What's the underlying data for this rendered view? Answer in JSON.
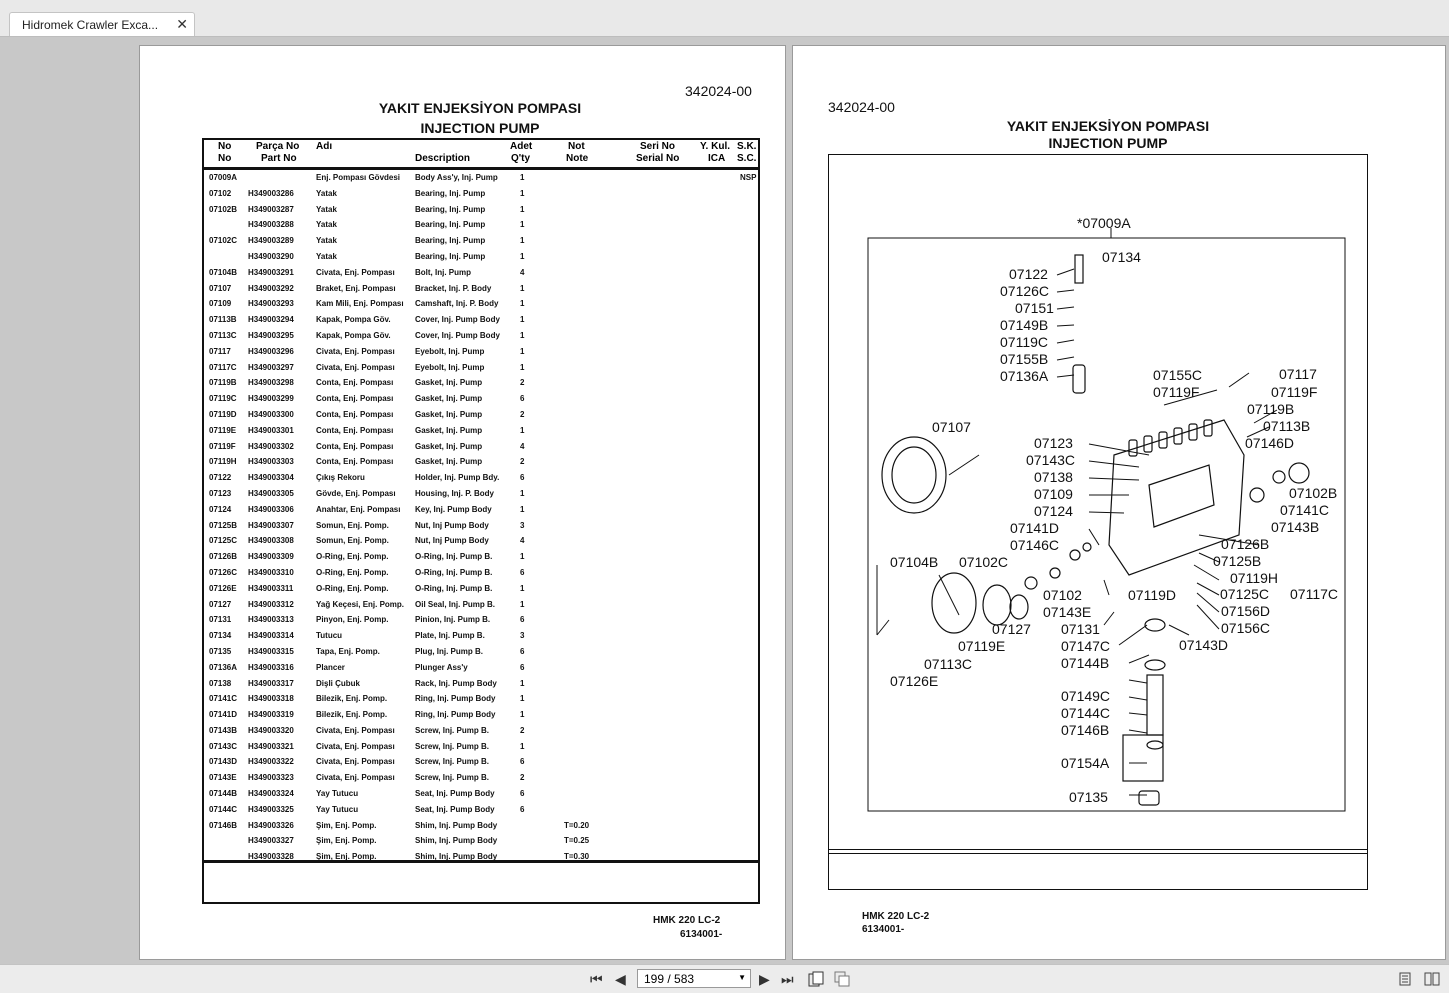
{
  "tab": {
    "title": "Hidromek Crawler Exca...",
    "close": "✕"
  },
  "left_page": {
    "doc_number": "342024-00",
    "title_tr": "YAKIT ENJEKSİYON POMPASI",
    "title_en": "INJECTION PUMP",
    "header": {
      "no_tr": "No",
      "no_en": "No",
      "part_tr": "Parça No",
      "part_en": "Part No",
      "name_tr": "Adı",
      "desc_en": "Description",
      "qty_tr": "Adet",
      "qty_en": "Q'ty",
      "note_tr": "Not",
      "note_en": "Note",
      "serial_tr": "Seri No",
      "serial_en": "Serial No",
      "yk_tr": "Y. Kul.",
      "yk_en": "ICA",
      "sk_tr": "S.K.",
      "sk_en": "S.C."
    },
    "rows": [
      [
        "07009A",
        "",
        "Enj. Pompası Gövdesi",
        "Body Ass'y, Inj. Pump",
        "1",
        "",
        "NSP"
      ],
      [
        "07102",
        "H349003286",
        "Yatak",
        "Bearing, Inj. Pump",
        "1",
        "",
        ""
      ],
      [
        "07102B",
        "H349003287",
        "Yatak",
        "Bearing, Inj. Pump",
        "1",
        "",
        ""
      ],
      [
        "",
        "H349003288",
        "Yatak",
        "Bearing, Inj. Pump",
        "1",
        "",
        ""
      ],
      [
        "07102C",
        "H349003289",
        "Yatak",
        "Bearing, Inj. Pump",
        "1",
        "",
        ""
      ],
      [
        "",
        "H349003290",
        "Yatak",
        "Bearing, Inj. Pump",
        "1",
        "",
        ""
      ],
      [
        "07104B",
        "H349003291",
        "Civata, Enj. Pompası",
        "Bolt, Inj. Pump",
        "4",
        "",
        ""
      ],
      [
        "07107",
        "H349003292",
        "Braket, Enj. Pompası",
        "Bracket, Inj. P. Body",
        "1",
        "",
        ""
      ],
      [
        "07109",
        "H349003293",
        "Kam Mili, Enj. Pompası",
        "Camshaft, Inj. P. Body",
        "1",
        "",
        ""
      ],
      [
        "07113B",
        "H349003294",
        "Kapak, Pompa Göv.",
        "Cover, Inj. Pump Body",
        "1",
        "",
        ""
      ],
      [
        "07113C",
        "H349003295",
        "Kapak, Pompa Göv.",
        "Cover, Inj. Pump Body",
        "1",
        "",
        ""
      ],
      [
        "07117",
        "H349003296",
        "Civata, Enj. Pompası",
        "Eyebolt, Inj. Pump",
        "1",
        "",
        ""
      ],
      [
        "07117C",
        "H349003297",
        "Civata, Enj. Pompası",
        "Eyebolt, Inj. Pump",
        "1",
        "",
        ""
      ],
      [
        "07119B",
        "H349003298",
        "Conta, Enj. Pompası",
        "Gasket, Inj. Pump",
        "2",
        "",
        ""
      ],
      [
        "07119C",
        "H349003299",
        "Conta, Enj. Pompası",
        "Gasket, Inj. Pump",
        "6",
        "",
        ""
      ],
      [
        "07119D",
        "H349003300",
        "Conta, Enj. Pompası",
        "Gasket, Inj. Pump",
        "2",
        "",
        ""
      ],
      [
        "07119E",
        "H349003301",
        "Conta, Enj. Pompası",
        "Gasket, Inj. Pump",
        "1",
        "",
        ""
      ],
      [
        "07119F",
        "H349003302",
        "Conta, Enj. Pompası",
        "Gasket, Inj. Pump",
        "4",
        "",
        ""
      ],
      [
        "07119H",
        "H349003303",
        "Conta, Enj. Pompası",
        "Gasket, Inj. Pump",
        "2",
        "",
        ""
      ],
      [
        "07122",
        "H349003304",
        "Çıkış Rekoru",
        "Holder, Inj. Pump Bdy.",
        "6",
        "",
        ""
      ],
      [
        "07123",
        "H349003305",
        "Gövde, Enj. Pompası",
        "Housing, Inj. P. Body",
        "1",
        "",
        ""
      ],
      [
        "07124",
        "H349003306",
        "Anahtar, Enj. Pompası",
        "Key, Inj. Pump Body",
        "1",
        "",
        ""
      ],
      [
        "07125B",
        "H349003307",
        "Somun, Enj. Pomp.",
        "Nut, Inj Pump Body",
        "3",
        "",
        ""
      ],
      [
        "07125C",
        "H349003308",
        "Somun, Enj. Pomp.",
        "Nut, Inj Pump Body",
        "4",
        "",
        ""
      ],
      [
        "07126B",
        "H349003309",
        "O-Ring, Enj. Pomp.",
        "O-Ring, Inj. Pump B.",
        "1",
        "",
        ""
      ],
      [
        "07126C",
        "H349003310",
        "O-Ring, Enj. Pomp.",
        "O-Ring, Inj. Pump B.",
        "6",
        "",
        ""
      ],
      [
        "07126E",
        "H349003311",
        "O-Ring, Enj. Pomp.",
        "O-Ring, Inj. Pump B.",
        "1",
        "",
        ""
      ],
      [
        "07127",
        "H349003312",
        "Yağ Keçesi, Enj. Pomp.",
        "Oil Seal, Inj. Pump B.",
        "1",
        "",
        ""
      ],
      [
        "07131",
        "H349003313",
        "Pinyon, Enj. Pomp.",
        "Pinion, Inj. Pump B.",
        "6",
        "",
        ""
      ],
      [
        "07134",
        "H349003314",
        "Tutucu",
        "Plate, Inj. Pump B.",
        "3",
        "",
        ""
      ],
      [
        "07135",
        "H349003315",
        "Tapa, Enj. Pomp.",
        "Plug, Inj. Pump B.",
        "6",
        "",
        ""
      ],
      [
        "07136A",
        "H349003316",
        "Plancer",
        "Plunger Ass'y",
        "6",
        "",
        ""
      ],
      [
        "07138",
        "H349003317",
        "Dişli Çubuk",
        "Rack, Inj. Pump Body",
        "1",
        "",
        ""
      ],
      [
        "07141C",
        "H349003318",
        "Bilezik, Enj. Pomp.",
        "Ring, Inj. Pump Body",
        "1",
        "",
        ""
      ],
      [
        "07141D",
        "H349003319",
        "Bilezik, Enj. Pomp.",
        "Ring, Inj. Pump Body",
        "1",
        "",
        ""
      ],
      [
        "07143B",
        "H349003320",
        "Civata, Enj. Pompası",
        "Screw, Inj. Pump B.",
        "2",
        "",
        ""
      ],
      [
        "07143C",
        "H349003321",
        "Civata, Enj. Pompası",
        "Screw, Inj. Pump B.",
        "1",
        "",
        ""
      ],
      [
        "07143D",
        "H349003322",
        "Civata, Enj. Pompası",
        "Screw, Inj. Pump B.",
        "6",
        "",
        ""
      ],
      [
        "07143E",
        "H349003323",
        "Civata, Enj. Pompası",
        "Screw, Inj. Pump B.",
        "2",
        "",
        ""
      ],
      [
        "07144B",
        "H349003324",
        "Yay Tutucu",
        "Seat, Inj. Pump Body",
        "6",
        "",
        ""
      ],
      [
        "07144C",
        "H349003325",
        "Yay Tutucu",
        "Seat, Inj. Pump Body",
        "6",
        "",
        ""
      ],
      [
        "07146B",
        "H349003326",
        "Şim, Enj. Pomp.",
        "Shim, Inj. Pump Body",
        "",
        "T=0.20",
        ""
      ],
      [
        "",
        "H349003327",
        "Şim, Enj. Pomp.",
        "Shim, Inj. Pump Body",
        "",
        "T=0.25",
        ""
      ],
      [
        "",
        "H349003328",
        "Şim, Enj. Pomp.",
        "Shim, Inj. Pump Body",
        "",
        "T=0.30",
        ""
      ]
    ],
    "footer_model": "HMK 220 LC-2",
    "footer_code": "6134001-"
  },
  "right_page": {
    "doc_number": "342024-00",
    "title_tr": "YAKIT ENJEKSİYON POMPASI",
    "title_en": "INJECTION PUMP",
    "footer_model": "HMK 220 LC-2",
    "footer_code": "6134001-",
    "callouts": [
      "*07009A",
      "07134",
      "07122",
      "07126C",
      "07151",
      "07149B",
      "07119C",
      "07155B",
      "07136A",
      "07155C",
      "07119F",
      "07117",
      "07119F",
      "07119B",
      "07113B",
      "07146D",
      "07107",
      "07123",
      "07143C",
      "07138",
      "07109",
      "07124",
      "07141D",
      "07146C",
      "07102C",
      "07104B",
      "07102B",
      "07141C",
      "07143B",
      "07126B",
      "07125B",
      "07119H",
      "07117C",
      "07125C",
      "07156D",
      "07156C",
      "07102",
      "07119D",
      "07143E",
      "07127",
      "07119E",
      "07131",
      "07143D",
      "07147C",
      "07113C",
      "07144B",
      "07126E",
      "07149C",
      "07144C",
      "07146B",
      "07154A",
      "07135"
    ]
  },
  "toolbar": {
    "page_value": "199 / 583",
    "first_icon": "⏮",
    "prev_icon": "◀",
    "next_icon": "▶",
    "last_icon": "⏭"
  }
}
